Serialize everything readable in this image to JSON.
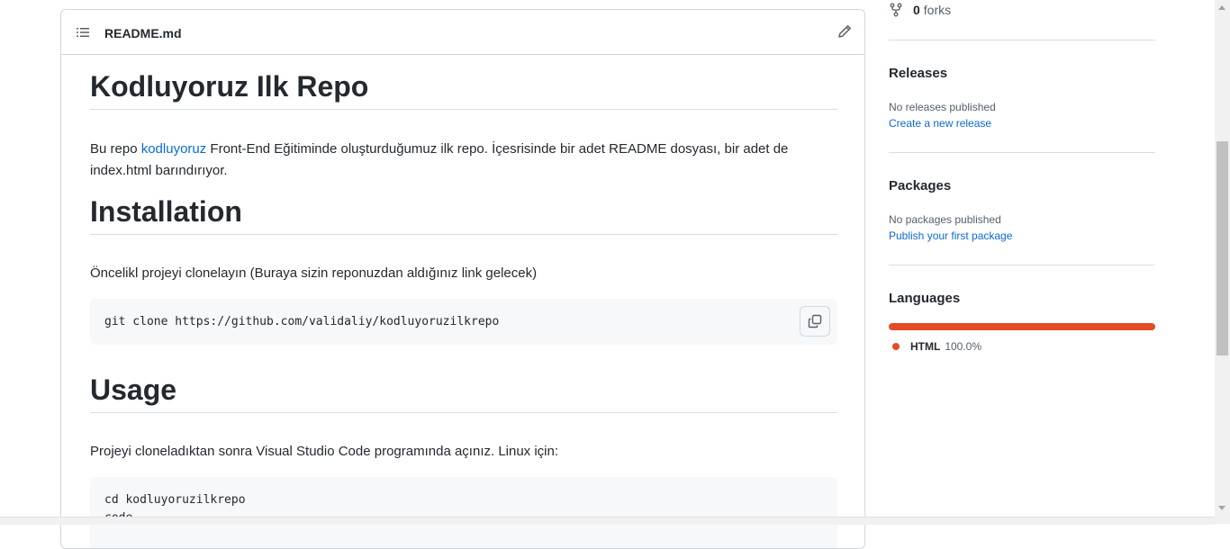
{
  "readme": {
    "filename": "README.md",
    "title": "Kodluyoruz Ilk Repo",
    "intro_before": "Bu repo ",
    "intro_link": "kodluyoruz",
    "intro_after": " Front-End Eğitiminde oluşturduğumuz ilk repo. İçesrisinde bir adet README dosyası, bir adet de index.html barındırıyor.",
    "installation_heading": "Installation",
    "installation_text": "Öncelikl projeyi clonelayın (Buraya sizin reponuzdan aldığınız link gelecek)",
    "clone_command": "git clone https://github.com/validaliy/kodluyoruzilkrepo",
    "usage_heading": "Usage",
    "usage_text": "Projeyi cloneladıktan sonra Visual Studio Code programında açınız. Linux için:",
    "usage_code": [
      "cd kodluyoruzilkrepo",
      "code ."
    ]
  },
  "sidebar": {
    "forks_count": "0",
    "forks_label": "forks",
    "releases_title": "Releases",
    "releases_text": "No releases published",
    "releases_link": "Create a new release",
    "packages_title": "Packages",
    "packages_text": "No packages published",
    "packages_link": "Publish your first package",
    "languages_title": "Languages",
    "languages": [
      {
        "name": "HTML",
        "percent": "100.0%",
        "color": "#e34c26"
      }
    ]
  },
  "icons": [
    "list-icon",
    "pencil-icon",
    "copy-icon",
    "fork-icon"
  ],
  "colors": {
    "link": "#0969da",
    "html_lang": "#e34c26",
    "border": "#d0d7de"
  }
}
